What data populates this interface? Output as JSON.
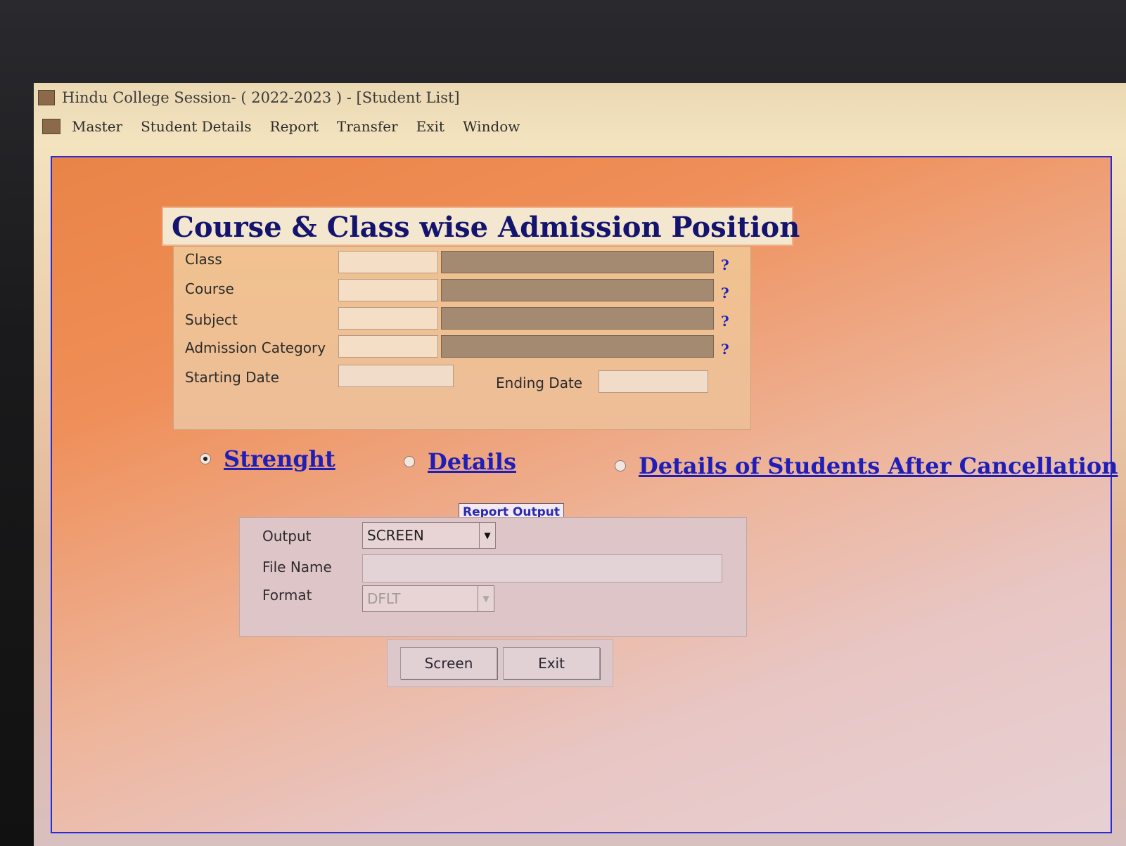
{
  "window": {
    "title": "Hindu College Session- ( 2022-2023 )  - [Student List]"
  },
  "menubar": {
    "items": [
      "Master",
      "Student Details",
      "Report",
      "Transfer",
      "Exit",
      "Window"
    ]
  },
  "form": {
    "title": "Course & Class wise Admission Position",
    "fields": {
      "class_label": "Class",
      "course_label": "Course",
      "subject_label": "Subject",
      "admission_category_label": "Admission Category",
      "starting_date_label": "Starting Date",
      "ending_date_label": "Ending Date",
      "lookup_symbol": "?"
    },
    "report_options": {
      "strength": "Strenght",
      "details": "Details",
      "cancellation": "Details of Students After Cancellation",
      "selected": "strength"
    },
    "report_output": {
      "caption": "Report Output",
      "output_label": "Output",
      "output_value": "SCREEN",
      "file_name_label": "File Name",
      "file_name_value": "",
      "format_label": "Format",
      "format_value": "DFLT"
    },
    "buttons": {
      "screen": "Screen",
      "exit": "Exit"
    }
  }
}
